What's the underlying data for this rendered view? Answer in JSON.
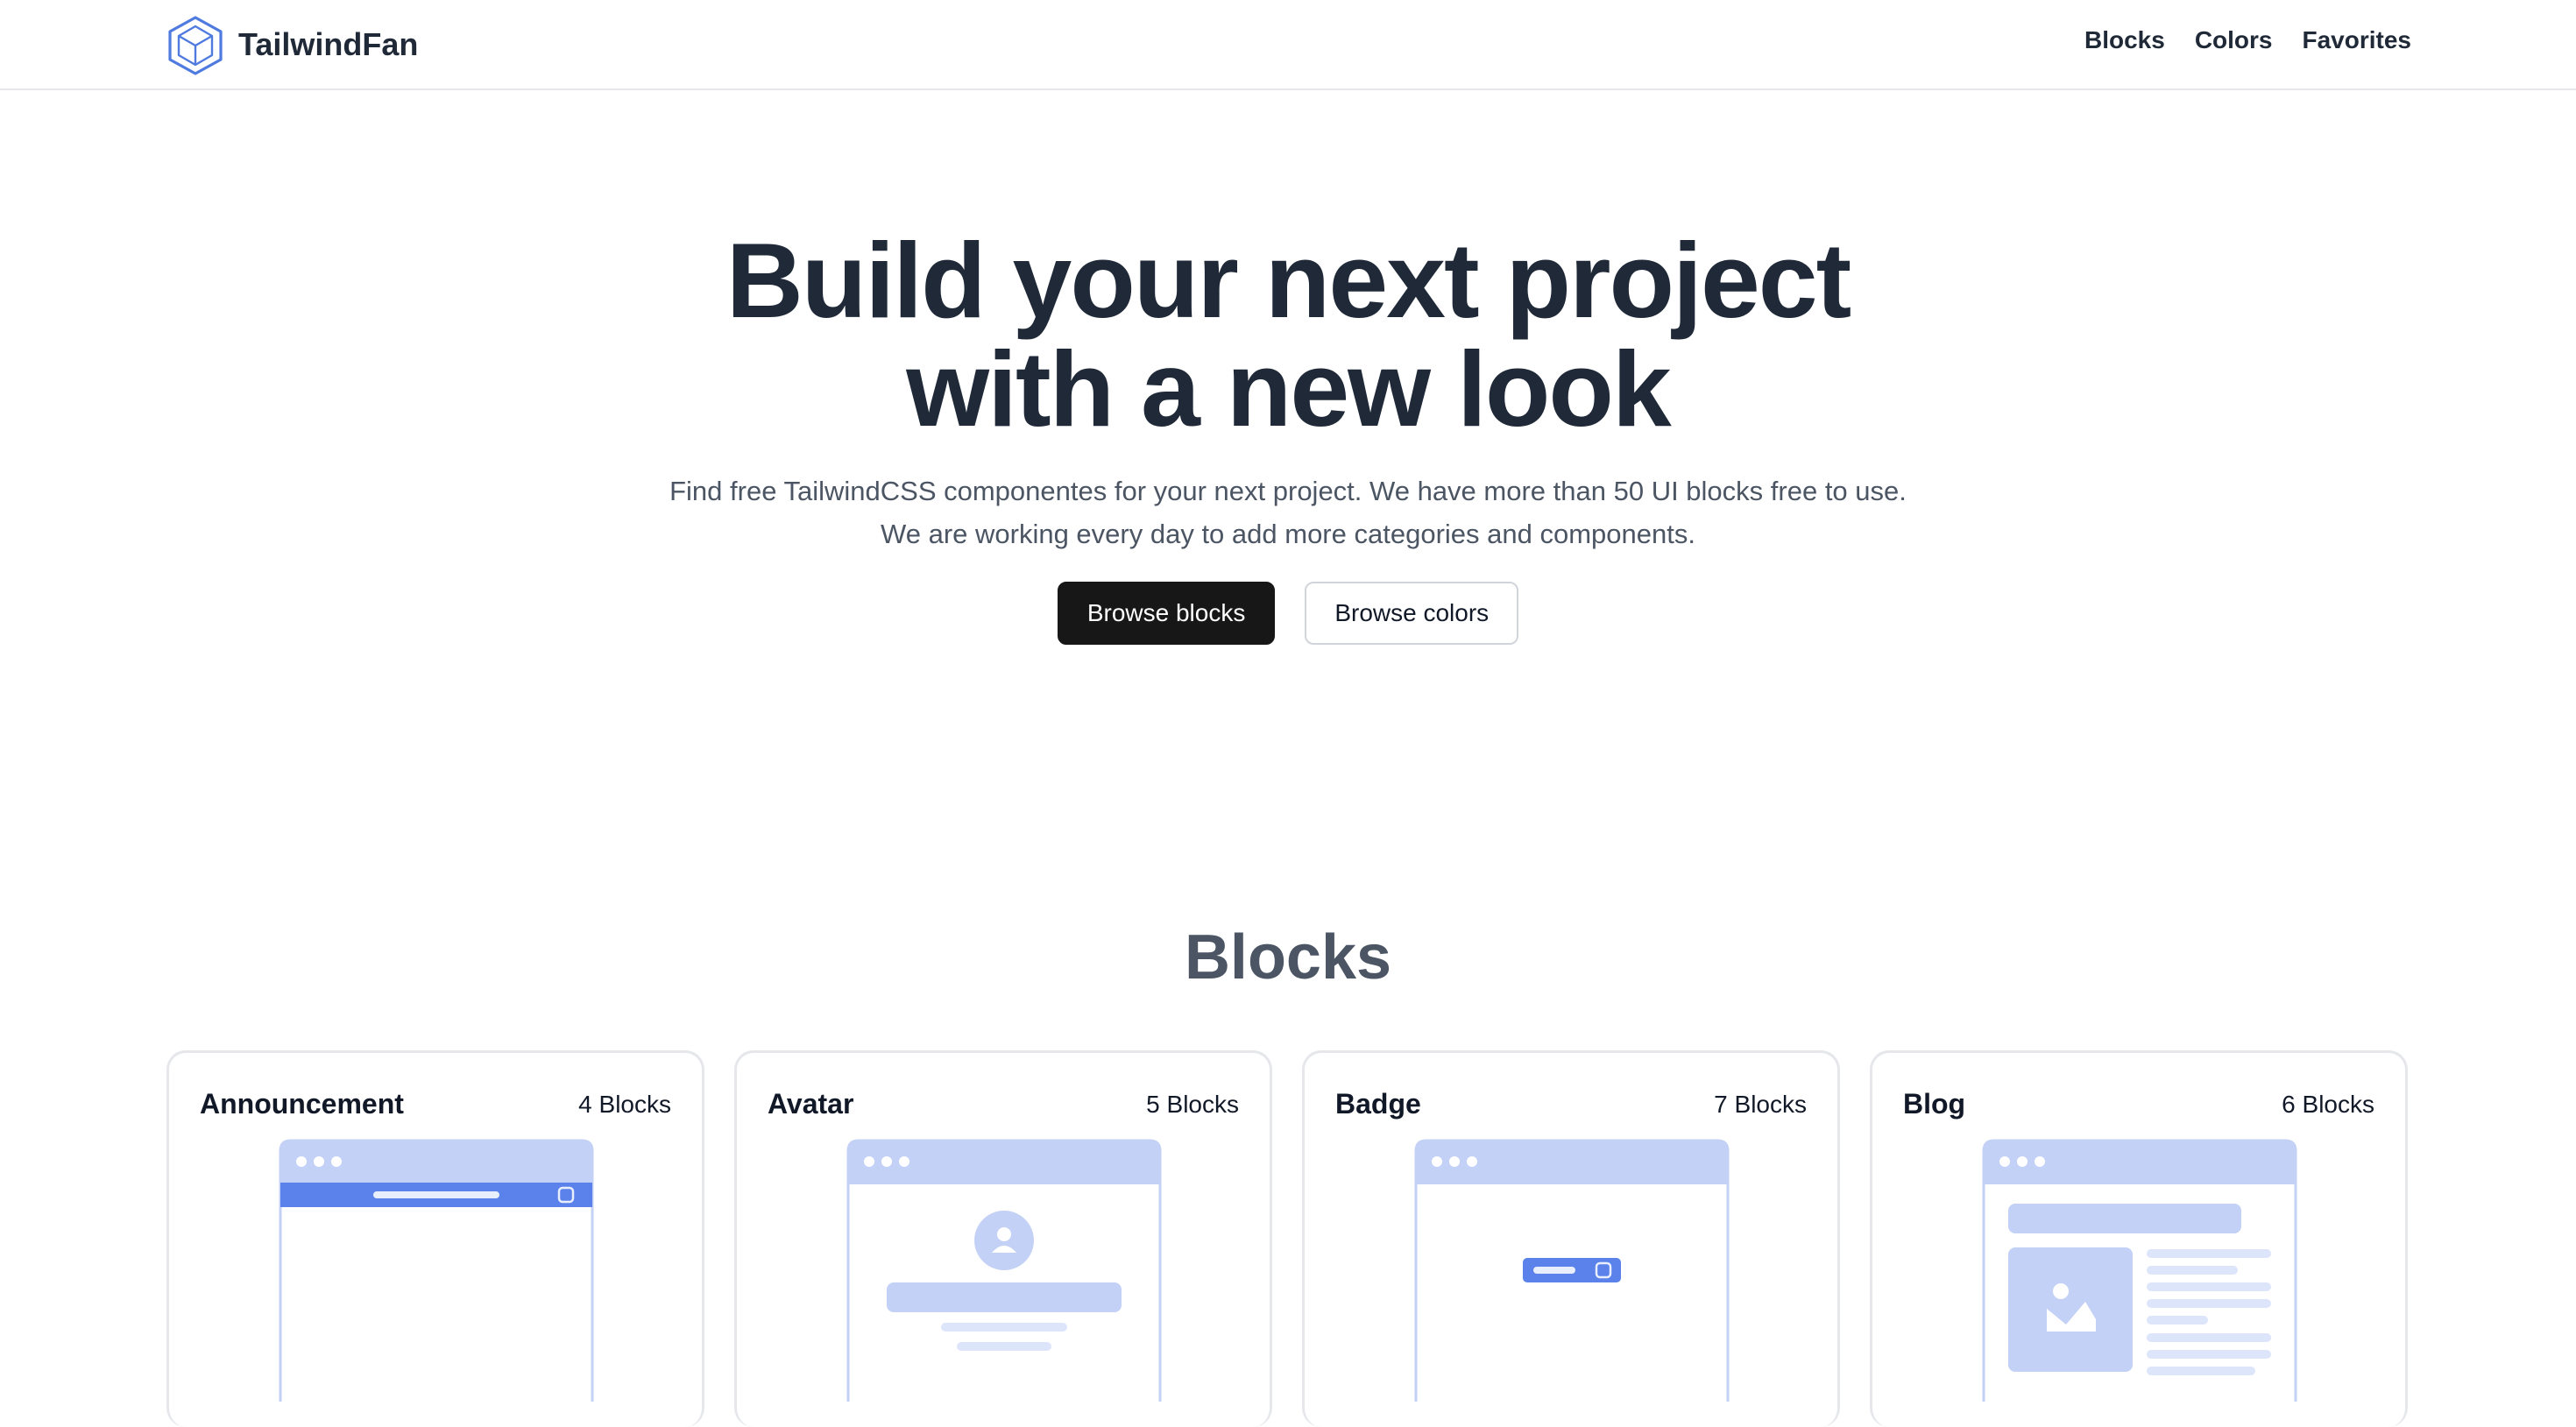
{
  "nav": {
    "brand": "TailwindFan",
    "logo_icon": "cube-icon",
    "links": [
      "Blocks",
      "Colors",
      "Favorites"
    ]
  },
  "hero": {
    "title_line1": "Build your next project",
    "title_line2": "with a new look",
    "subtitle_line1": "Find free TailwindCSS componentes for your next project. We have more than 50 UI blocks free to use.",
    "subtitle_line2": "We are working every day to add more categories and components.",
    "primary_button": "Browse blocks",
    "secondary_button": "Browse colors"
  },
  "blocks_section": {
    "title": "Blocks",
    "cards": [
      {
        "title": "Announcement",
        "count": "4 Blocks",
        "illustration": "announcement-preview"
      },
      {
        "title": "Avatar",
        "count": "5 Blocks",
        "illustration": "avatar-preview"
      },
      {
        "title": "Badge",
        "count": "7 Blocks",
        "illustration": "badge-preview"
      },
      {
        "title": "Blog",
        "count": "6 Blocks",
        "illustration": "blog-preview"
      }
    ]
  },
  "colors": {
    "text_dark": "#1f2937",
    "text_muted": "#4b5563",
    "primary_button_bg": "#171717",
    "illustration_light": "#c3d1f6",
    "illustration_accent": "#5b82ea",
    "logo_blue": "#4f7ae0"
  }
}
